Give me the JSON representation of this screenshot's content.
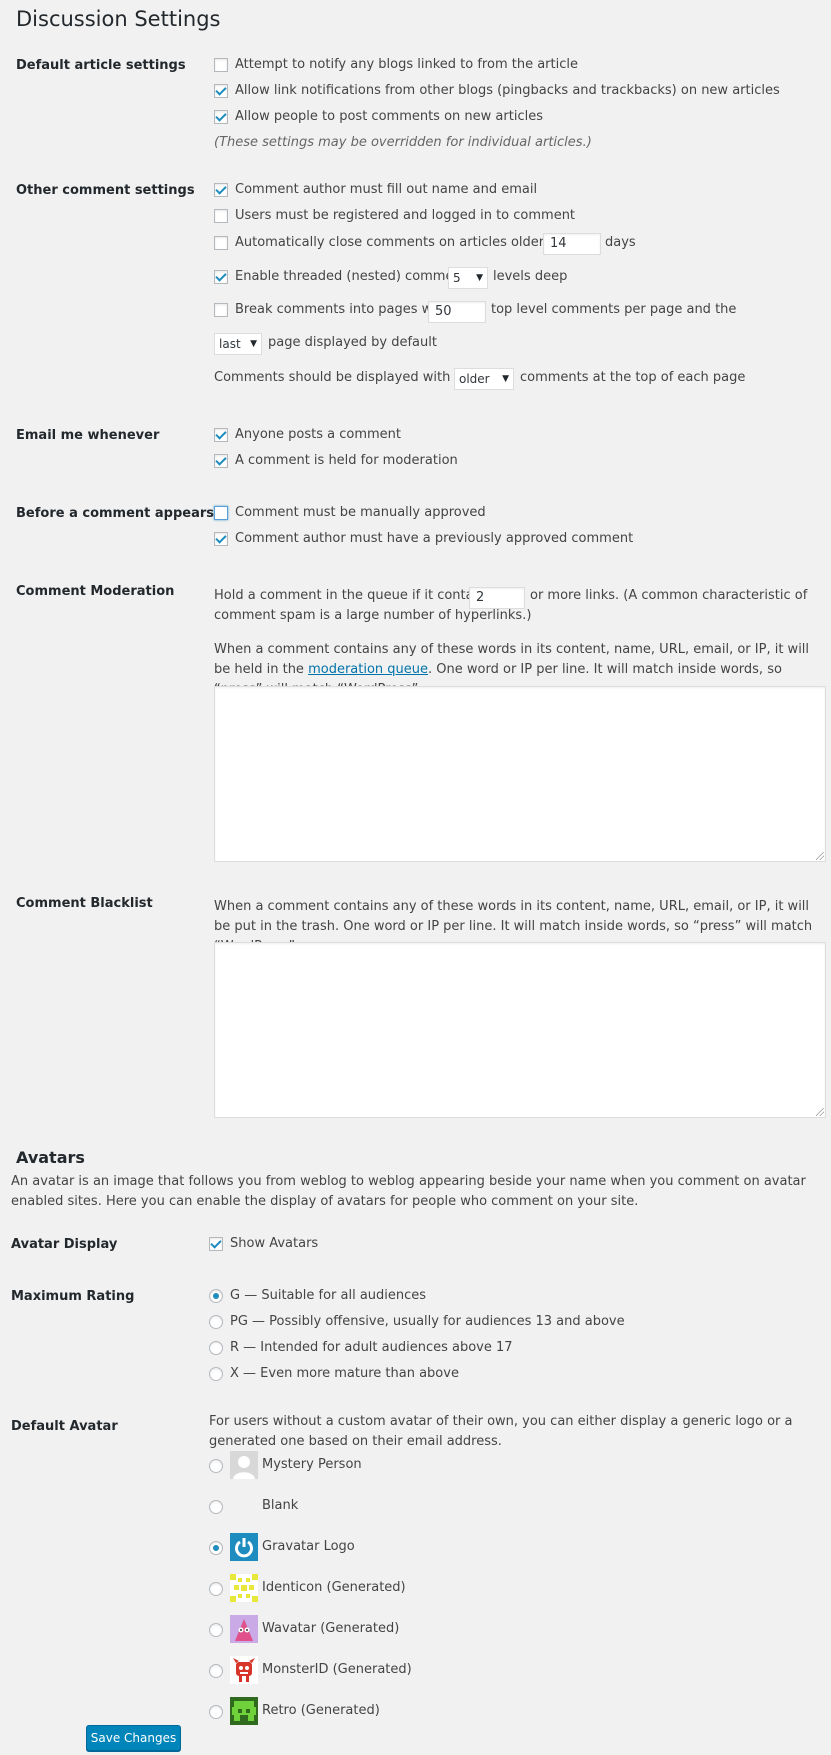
{
  "page": {
    "title": "Discussion Settings"
  },
  "default_article": {
    "label": "Default article settings",
    "options": [
      {
        "label": "Attempt to notify any blogs linked to from the article",
        "checked": false
      },
      {
        "label": "Allow link notifications from other blogs (pingbacks and trackbacks) on new articles",
        "checked": true
      },
      {
        "label": "Allow people to post comments on new articles",
        "checked": true
      }
    ],
    "note": "(These settings may be overridden for individual articles.)"
  },
  "other_comment": {
    "label": "Other comment settings",
    "require_name_email": "Comment author must fill out name and email",
    "registered_only": "Users must be registered and logged in to comment",
    "close_prefix": "Automatically close comments on articles older than",
    "close_days": "14",
    "close_suffix": "days",
    "threaded_prefix": "Enable threaded (nested) comments",
    "threaded_levels": "5",
    "threaded_suffix": "levels deep",
    "paging_prefix": "Break comments into pages with",
    "paging_count": "50",
    "paging_suffix": "top level comments per page and the",
    "page_default_select": "last",
    "page_default_suffix": "page displayed by default",
    "order_prefix": "Comments should be displayed with the",
    "order_select": "older",
    "order_suffix": "comments at the top of each page"
  },
  "email_me": {
    "label": "Email me whenever",
    "options": [
      "Anyone posts a comment",
      "A comment is held for moderation"
    ]
  },
  "before_appears": {
    "label": "Before a comment appears",
    "options": [
      "Comment must be manually approved",
      "Comment author must have a previously approved comment"
    ]
  },
  "moderation": {
    "label": "Comment Moderation",
    "links_prefix": "Hold a comment in the queue if it contains",
    "links_count": "2",
    "links_suffix": "or more links. (A common characteristic of comment spam is a large number of hyperlinks.)",
    "words_text_1": "When a comment contains any of these words in its content, name, URL, email, or IP, it will be held in the",
    "words_link": "moderation queue",
    "words_text_2": ". One word or IP per line. It will match inside words, so “press” will match “WordPress”."
  },
  "blacklist": {
    "label": "Comment Blacklist",
    "text": "When a comment contains any of these words in its content, name, URL, email, or IP, it will be put in the trash. One word or IP per line. It will match inside words, so “press” will match “WordPress”."
  },
  "avatars": {
    "heading": "Avatars",
    "intro": "An avatar is an image that follows you from weblog to weblog appearing beside your name when you comment on avatar enabled sites. Here you can enable the display of avatars for people who comment on your site.",
    "display_label": "Avatar Display",
    "show_avatars": "Show Avatars",
    "rating_label": "Maximum Rating",
    "ratings": [
      "G — Suitable for all audiences",
      "PG — Possibly offensive, usually for audiences 13 and above",
      "R — Intended for adult audiences above 17",
      "X — Even more mature than above"
    ],
    "default_label": "Default Avatar",
    "default_desc": "For users without a custom avatar of their own, you can either display a generic logo or a generated one based on their email address.",
    "defaults": [
      "Mystery Person",
      "Blank",
      "Gravatar Logo",
      "Identicon (Generated)",
      "Wavatar (Generated)",
      "MonsterID (Generated)",
      "Retro (Generated)"
    ]
  },
  "save_button": "Save Changes"
}
